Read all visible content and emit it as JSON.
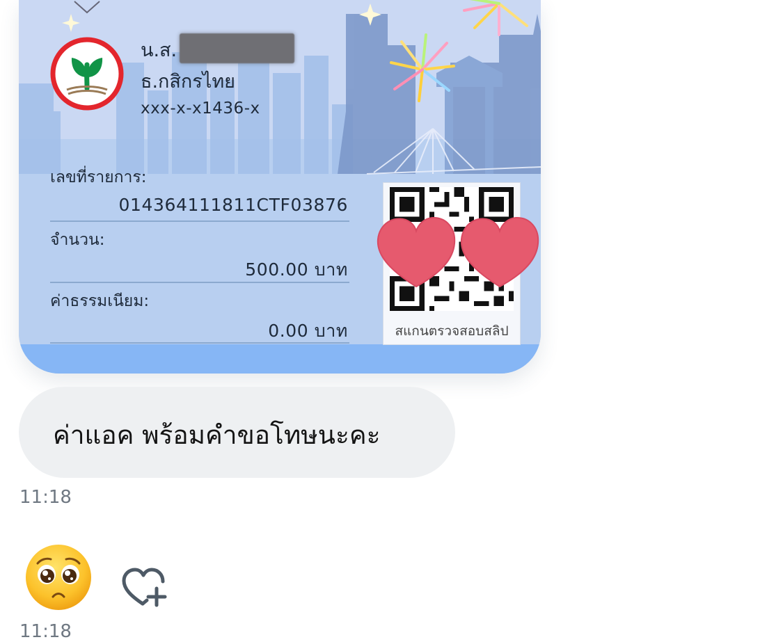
{
  "slip": {
    "sender_prefix": "น.ส.",
    "sender_bank": "ธ.กสิกรไทย",
    "sender_account": "xxx-x-x1436-x",
    "txn_label": "เลขที่รายการ:",
    "txn_value": "014364111811CTF03876",
    "amount_label": "จำนวน:",
    "amount_value": "500.00 บาท",
    "fee_label": "ค่าธรรมเนียม:",
    "fee_value": "0.00 บาท",
    "qr_caption": "สแกนตรวจสอบสลิป",
    "bank_logo_icon": "kasikorn-bank-logo",
    "colors": {
      "logo_red": "#e3262d",
      "logo_green": "#119447",
      "card_bottom": "#86b6f5",
      "heart": "#e65a6e"
    }
  },
  "messages": [
    {
      "text": "ค่าแอค พร้อมคำขอโทษนะคะ",
      "time": "11:18"
    },
    {
      "emoji": "🥺",
      "time": "11:18"
    }
  ],
  "reaction": {
    "icon": "heart-plus-icon"
  }
}
